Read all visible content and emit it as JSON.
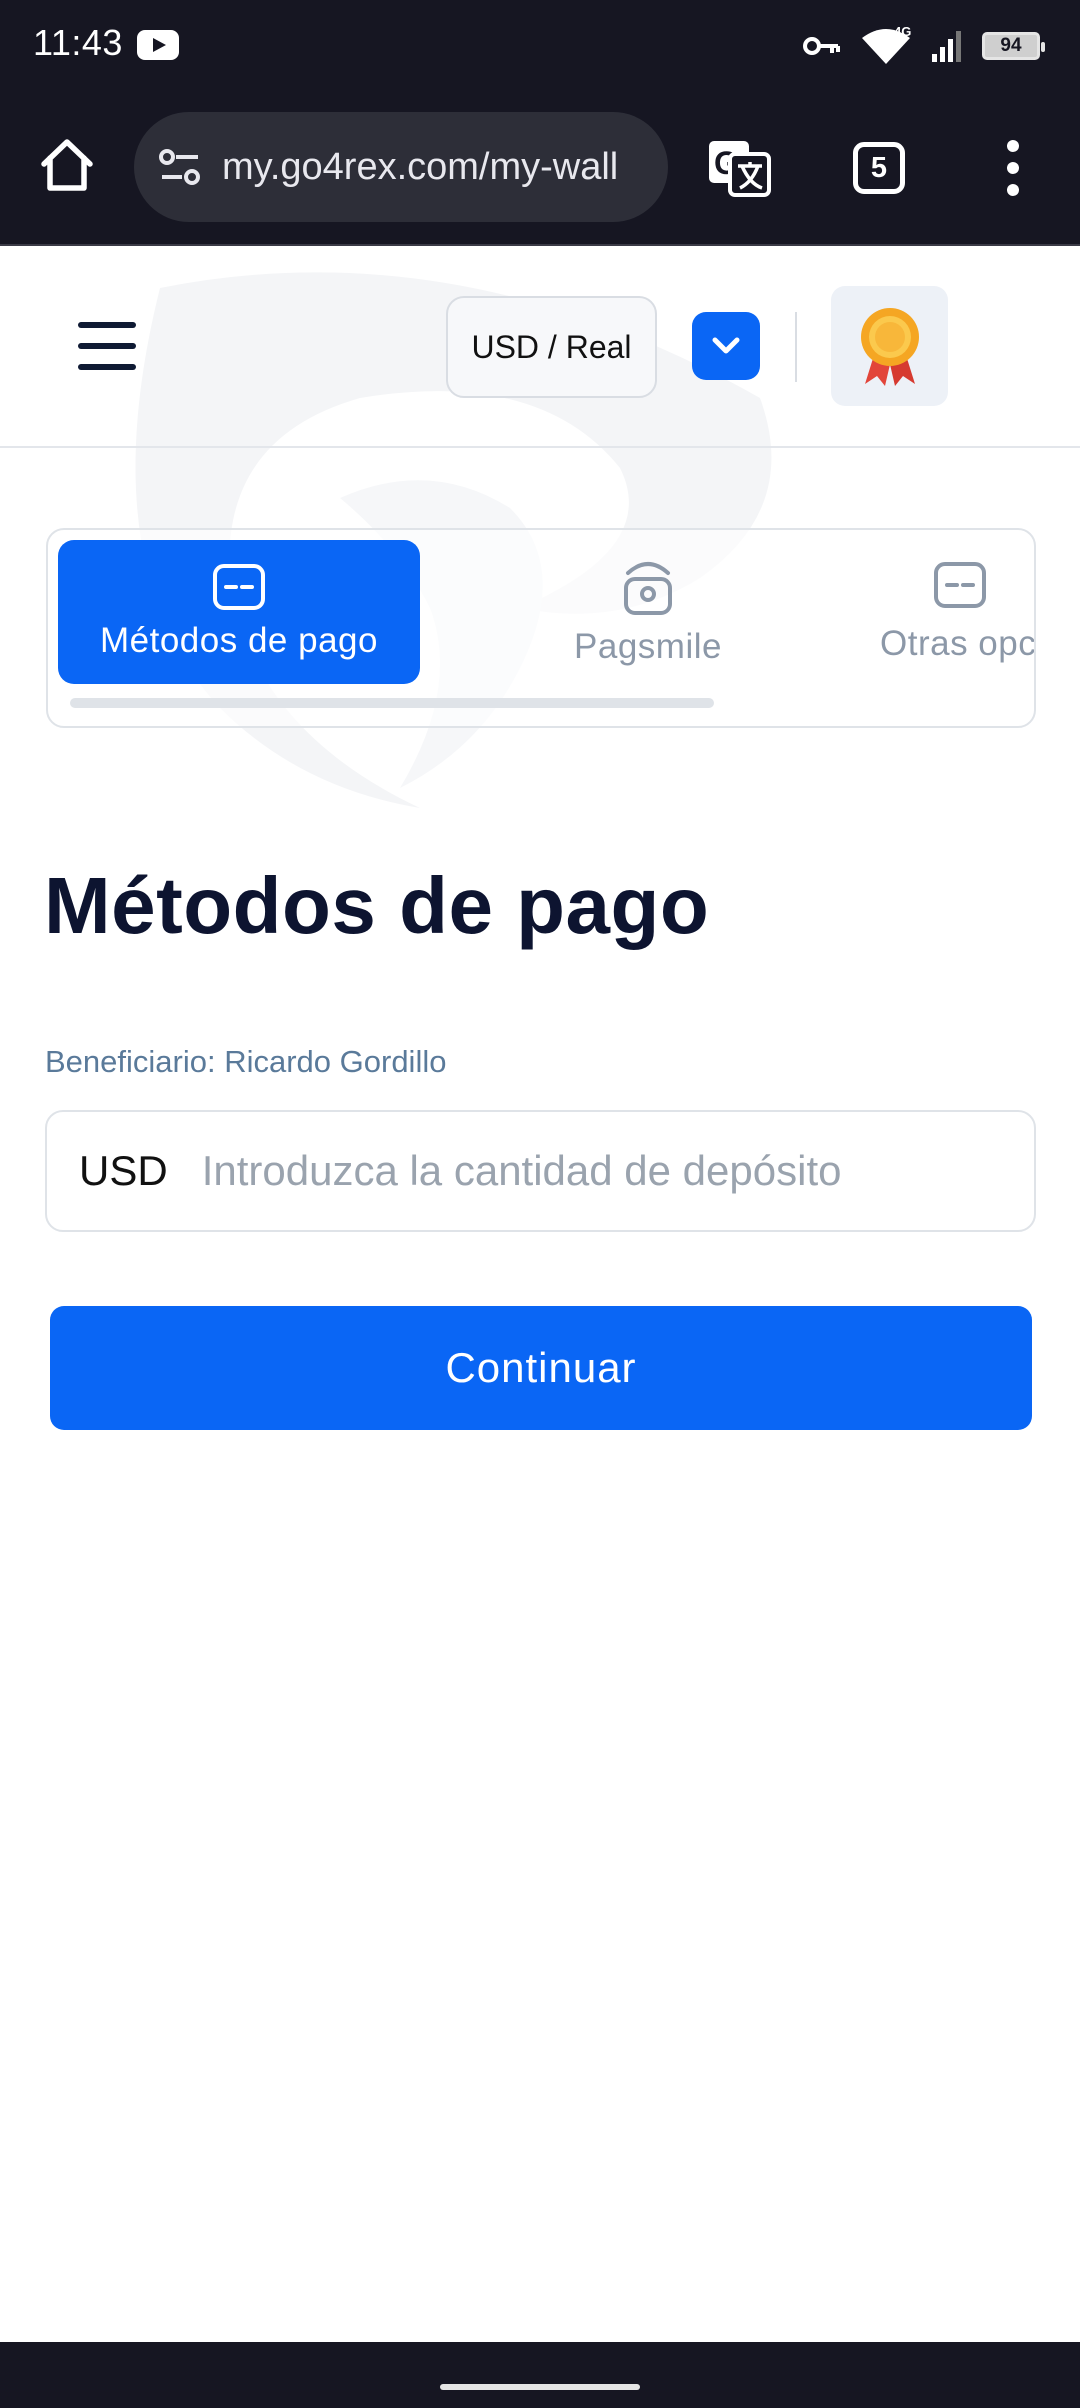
{
  "status_bar": {
    "time": "11:43",
    "battery": "94",
    "icons": [
      "youtube-icon",
      "vpn-key-icon",
      "wifi-icon",
      "signal-4g-icon",
      "battery-icon"
    ]
  },
  "browser": {
    "url": "my.go4rex.com/my-wall",
    "tab_count": "5"
  },
  "header": {
    "account_type": "USD / Real"
  },
  "method_tabs": [
    {
      "label": "Métodos de pago",
      "active": true
    },
    {
      "label": "Pagsmile",
      "active": false
    },
    {
      "label": "Otras opcic",
      "active": false
    }
  ],
  "main": {
    "title": "Métodos de pago",
    "beneficiary": "Beneficiario: Ricardo Gordillo",
    "amount": {
      "currency": "USD",
      "placeholder": "Introduzca la cantidad de depósito"
    },
    "continue_label": "Continuar"
  },
  "colors": {
    "accent": "#0a66f5",
    "status_bar": "#161622",
    "muted_text": "#8c98a8"
  }
}
